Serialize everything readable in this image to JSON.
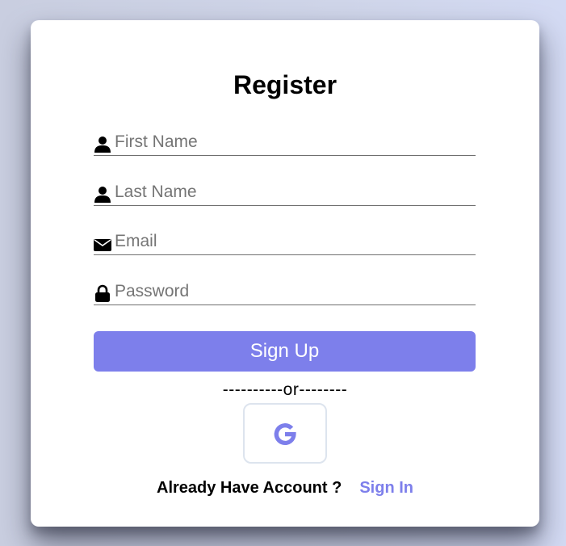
{
  "form": {
    "title": "Register",
    "first_name": {
      "placeholder": "First Name",
      "value": "",
      "icon": "user-icon"
    },
    "last_name": {
      "placeholder": "Last Name",
      "value": "",
      "icon": "user-icon"
    },
    "email": {
      "placeholder": "Email",
      "value": "",
      "icon": "envelope-icon"
    },
    "password": {
      "placeholder": "Password",
      "value": "",
      "icon": "lock-icon"
    },
    "signup_label": "Sign Up",
    "divider_text": "----------or--------",
    "google_icon": "google-icon"
  },
  "footer": {
    "question": "Already Have Account ?",
    "signin_label": "Sign In"
  },
  "colors": {
    "accent": "#7d7feb",
    "card": "#ffffff",
    "underline": "#6f6f6f",
    "google_border": "#dde4ee"
  }
}
